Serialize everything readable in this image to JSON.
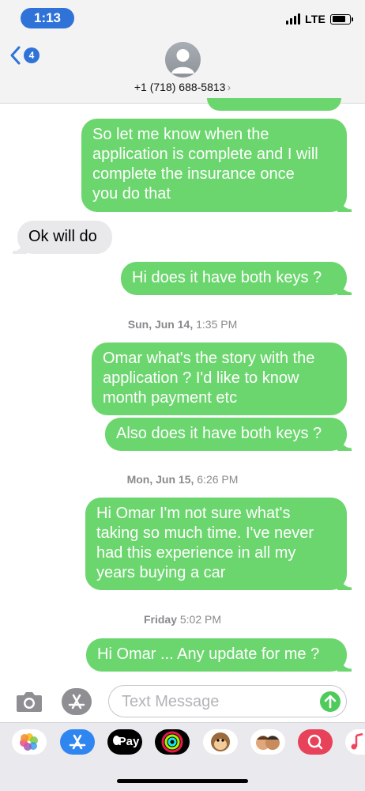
{
  "status_bar": {
    "time": "1:13",
    "network": "LTE"
  },
  "header": {
    "back_badge": "4",
    "contact": "+1 (718) 688-5813",
    "contact_chevron": "›"
  },
  "messages": [
    {
      "dir": "out",
      "text": "So let me know when the\napplication is complete and I will\ncomplete the insurance once\nyou do that"
    },
    {
      "dir": "in",
      "text": "Ok will do"
    },
    {
      "dir": "out",
      "text": "Hi does it have both keys ?"
    },
    {
      "dir": "out",
      "text": "Omar what's the story with the\napplication ? I'd like to know\nmonth payment etc"
    },
    {
      "dir": "out",
      "text": "Also does it have both keys ?"
    },
    {
      "dir": "out",
      "text": "Hi Omar I'm not sure what's\ntaking so much time.  I've never\nhad this experience in all my\nyears buying a car"
    },
    {
      "dir": "out",
      "text": "Hi Omar ... Any update for me ?"
    }
  ],
  "timestamps": [
    {
      "day": "Sun, Jun 14,",
      "time": "1:35 PM"
    },
    {
      "day": "Mon, Jun 15,",
      "time": "6:26 PM"
    },
    {
      "day": "Friday",
      "time": "5:02 PM"
    }
  ],
  "input": {
    "placeholder": "Text Message"
  },
  "drawer": {
    "apple_pay_label": "Pay",
    "icons": [
      "photos-icon",
      "app-store-icon",
      "apple-pay-icon",
      "activity-icon",
      "monkey-memoji-icon",
      "memoji-icon",
      "search-images-icon",
      "music-icon"
    ]
  },
  "colors": {
    "outgoing": "#6cd66e",
    "incoming": "#e9e9eb",
    "accent": "#2f73d8"
  }
}
